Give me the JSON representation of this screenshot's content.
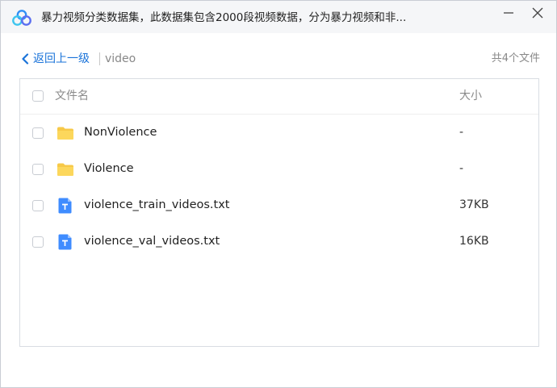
{
  "window": {
    "title": "暴力视频分类数据集，此数据集包含2000段视频数据，分为暴力视频和非...",
    "controls": [
      "minimize-icon",
      "close-icon"
    ]
  },
  "nav": {
    "back_label": "返回上一级",
    "current_dir": "video",
    "file_count": "共4个文件"
  },
  "table": {
    "columns": {
      "name": "文件名",
      "size": "大小"
    },
    "rows": [
      {
        "name": "NonViolence",
        "size": "-",
        "icon": "folder-icon"
      },
      {
        "name": "Violence",
        "size": "-",
        "icon": "folder-icon"
      },
      {
        "name": "violence_train_videos.txt",
        "size": "37KB",
        "icon": "text-file-icon"
      },
      {
        "name": "violence_val_videos.txt",
        "size": "16KB",
        "icon": "text-file-icon"
      }
    ]
  },
  "colors": {
    "accent": "#1a73d9",
    "folder": "#f7c948",
    "txt_icon": "#3f8cff"
  }
}
